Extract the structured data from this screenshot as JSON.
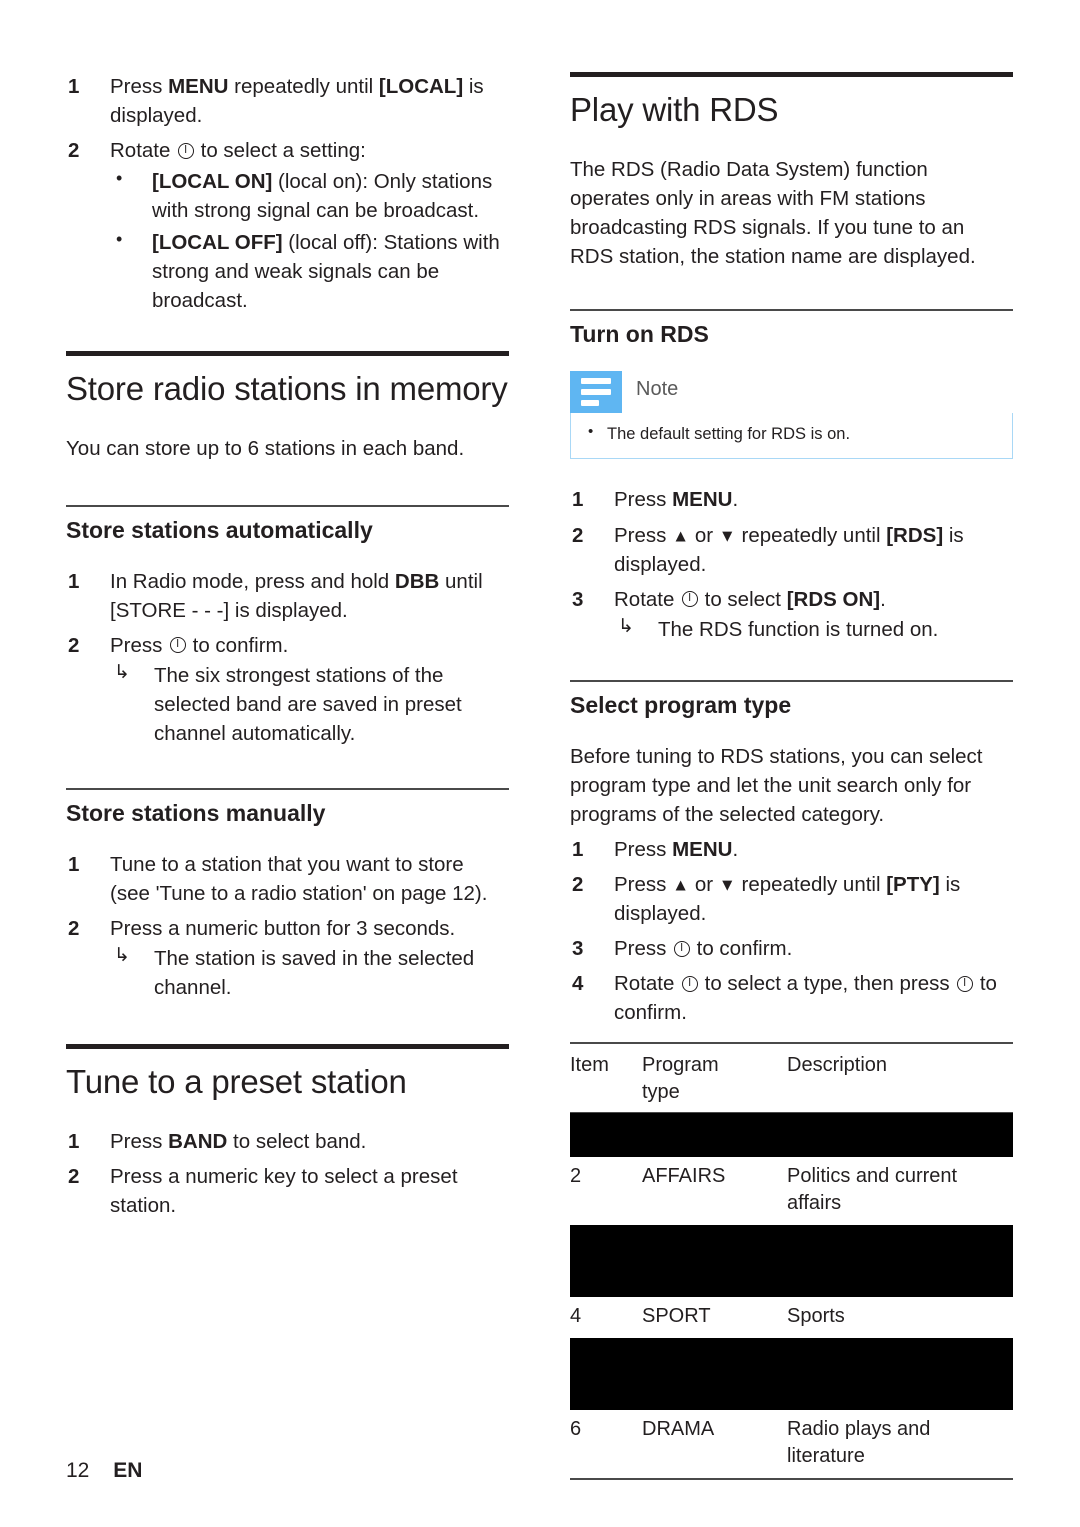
{
  "page": {
    "number": "12",
    "language": "EN"
  },
  "left_column": {
    "local_steps": [
      {
        "num": "1",
        "text_parts": [
          {
            "t": "Press ",
            "b": false
          },
          {
            "t": "MENU",
            "b": true
          },
          {
            "t": " repeatedly until ",
            "b": false
          },
          {
            "t": "[LOCAL]",
            "b": true
          },
          {
            "t": " is displayed.",
            "b": false
          }
        ]
      },
      {
        "num": "2",
        "text_parts": [
          {
            "t": "Rotate ",
            "b": false
          },
          {
            "t": "@PWR@",
            "b": false
          },
          {
            "t": " to select a setting:",
            "b": false
          }
        ]
      }
    ],
    "local_step1_full": "Press MENU repeatedly until [LOCAL] is displayed.",
    "local_step2_full": "Rotate ⏻ to select a setting:",
    "local_bullets": [
      {
        "label": "[LOCAL ON]",
        "rest": " (local on): Only stations with strong signal can be broadcast."
      },
      {
        "label": "[LOCAL OFF]",
        "rest": " (local off): Stations with strong and weak signals can be broadcast."
      }
    ],
    "store_memory": {
      "title": "Store radio stations in memory",
      "intro": "You can store up to 6 stations in each band."
    },
    "store_auto": {
      "title": "Store stations automatically",
      "step1_a": "In Radio mode, press and hold ",
      "step1_bold": "DBB",
      "step1_b": " until ",
      "step1_bold2": "[STORE - - -]",
      "step1_c": " is displayed.",
      "step2_a": "Press ",
      "step2_b": " to confirm.",
      "step2_result": "The six strongest stations of the selected band are saved in preset channel automatically."
    },
    "store_manual": {
      "title": "Store stations manually",
      "step1": "Tune to a station that you want to store (see 'Tune to a radio station' on page 12).",
      "step2": "Press a numeric button for 3 seconds.",
      "step2_result": "The station is saved in the selected channel."
    },
    "preset": {
      "title": "Tune to a preset station",
      "step1_a": "Press ",
      "step1_bold": "BAND",
      "step1_b": " to select band.",
      "step2": "Press a numeric key to select a preset station."
    }
  },
  "right_column": {
    "rds": {
      "title": "Play with RDS",
      "intro": "The RDS (Radio Data System) function operates only in areas with FM stations broadcasting RDS signals. If you tune to an RDS station, the station name are displayed."
    },
    "turn_on_rds": {
      "title": "Turn on RDS",
      "note": {
        "label": "Note",
        "icon": "note-lines-icon",
        "accent_color": "#5fb6f2",
        "border_color": "#a9d8f6",
        "bullet": "The default setting for RDS is on."
      },
      "step1_a": "Press ",
      "step1_bold": "MENU",
      "step1_b": ".",
      "step2_a": "Press ",
      "step2_up": "▲",
      "step2_mid": " or ",
      "step2_down": "▼",
      "step2_b": " repeatedly until ",
      "step2_bold": "[RDS]",
      "step2_c": " is displayed.",
      "step3_a": "Rotate ",
      "step3_b": " to select ",
      "step3_bold": "[RDS ON]",
      "step3_c": ".",
      "step3_result": "The RDS function is turned on."
    },
    "select_program_type": {
      "title": "Select program type",
      "intro": "Before tuning to RDS stations, you can select program type and let the unit search only for programs of the selected category.",
      "step1_a": "Press ",
      "step1_bold": "MENU",
      "step1_b": ".",
      "step2_a": "Press ",
      "step2_up": "▲",
      "step2_mid": " or ",
      "step2_down": "▼",
      "step2_b": " repeatedly until ",
      "step2_bold": "[PTY]",
      "step2_c": " is displayed.",
      "step3_a": "Press ",
      "step3_b": " to confirm.",
      "step4_a": "Rotate ",
      "step4_b": " to select a type, then press ",
      "step4_c": " to confirm."
    },
    "program_table": {
      "columns": [
        "Item",
        "Program type",
        "Description"
      ],
      "col_item": "Item",
      "col_type_line1": "Program",
      "col_type_line2": "type",
      "col_desc": "Description",
      "rows": [
        {
          "redacted": true,
          "height": "1line",
          "item": "",
          "type": "",
          "desc": ""
        },
        {
          "redacted": false,
          "item": "2",
          "type": "AFFAIRS",
          "desc": "Politics and current affairs"
        },
        {
          "redacted": true,
          "height": "2line",
          "item": "",
          "type": "",
          "desc": ""
        },
        {
          "redacted": false,
          "item": "4",
          "type": "SPORT",
          "desc": "Sports"
        },
        {
          "redacted": true,
          "height": "2line",
          "item": "",
          "type": "",
          "desc": ""
        },
        {
          "redacted": false,
          "item": "6",
          "type": "DRAMA",
          "desc": "Radio plays and literature"
        }
      ]
    }
  }
}
